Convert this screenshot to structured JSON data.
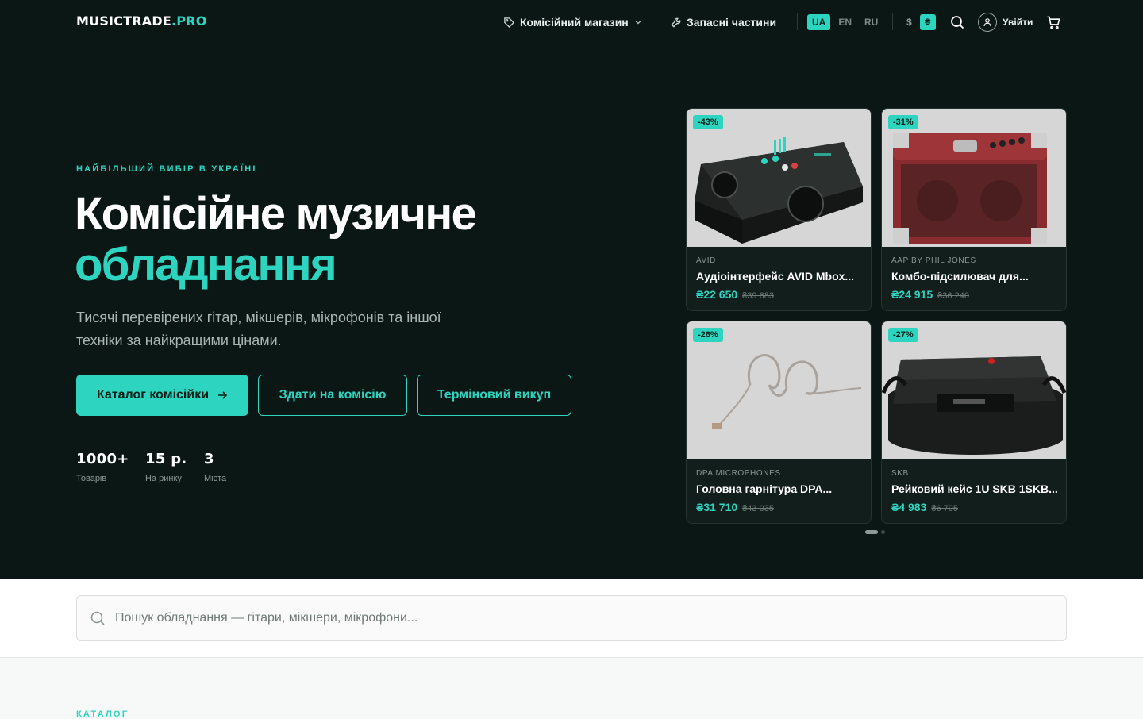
{
  "header": {
    "logo_main": "MUSICTRADE",
    "logo_accent": ".PRO",
    "nav_shop": "Комісійний магазин",
    "nav_parts": "Запасні частини",
    "languages": [
      "UA",
      "EN",
      "RU"
    ],
    "active_language": "UA",
    "currency_usd": "$",
    "currency_uah": "₴",
    "login": "Увійти"
  },
  "hero": {
    "eyebrow": "НАЙБІЛЬШИЙ ВИБІР В УКРАЇНІ",
    "title_line1": "Комісійне музичне",
    "title_line2": "обладнання",
    "lead": "Тисячі перевірених гітар, мікшерів, мікрофонів та іншої техніки за найкращими цінами.",
    "btn_catalog": "Каталог комісійки",
    "btn_consign": "Здати на комісію",
    "btn_buyout": "Терміновий викуп",
    "stats": [
      {
        "value": "1000+",
        "label": "Товарів"
      },
      {
        "value": "15 р.",
        "label": "На ринку"
      },
      {
        "value": "3",
        "label": "Міста"
      }
    ]
  },
  "products": [
    {
      "discount": "-43%",
      "brand": "AVID",
      "name": "Аудіоінтерфейс AVID Mbox...",
      "price": "₴22 650",
      "old_price": "₴39 683"
    },
    {
      "discount": "-31%",
      "brand": "AAP BY PHIL JONES",
      "name": "Комбо-підсилювач для...",
      "price": "₴24 915",
      "old_price": "₴36 240"
    },
    {
      "discount": "-26%",
      "brand": "DPA MICROPHONES",
      "name": "Головна гарнітура DPA...",
      "price": "₴31 710",
      "old_price": "₴43 035"
    },
    {
      "discount": "-27%",
      "brand": "SKB",
      "name": "Рейковий кейс 1U SKB 1SKB...",
      "price": "₴4 983",
      "old_price": "₴6 795"
    }
  ],
  "carousel": {
    "pages": 2,
    "active": 1
  },
  "search": {
    "placeholder": "Пошук обладнання — гітари, мікшери, мікрофони..."
  },
  "next_section": {
    "label": "КАТАЛОГ"
  },
  "colors": {
    "accent": "#2dd4bf",
    "hero_bg": "#0b1714",
    "card_bg": "#121e1b"
  }
}
